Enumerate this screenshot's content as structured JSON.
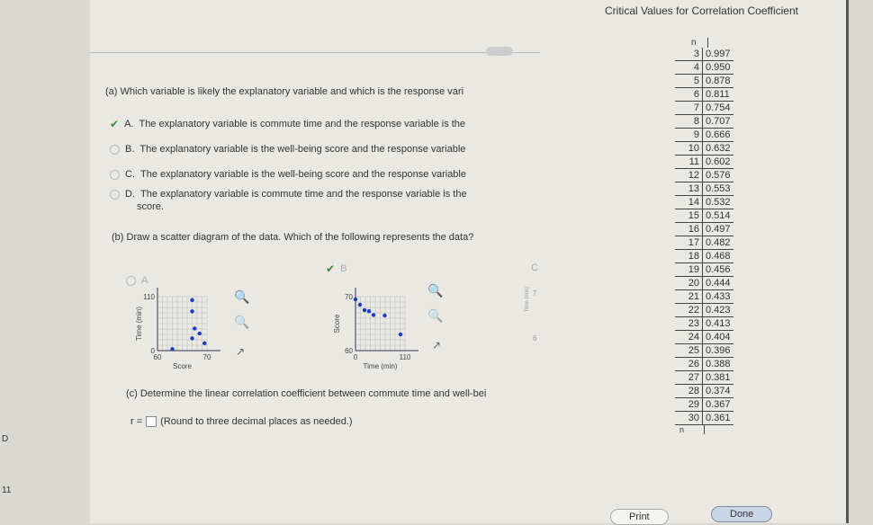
{
  "table": {
    "title": "Critical Values for Correlation Coefficient",
    "col_header": "n",
    "rows": [
      [
        3,
        "0.997"
      ],
      [
        4,
        "0.950"
      ],
      [
        5,
        "0.878"
      ],
      [
        6,
        "0.811"
      ],
      [
        7,
        "0.754"
      ],
      [
        8,
        "0.707"
      ],
      [
        9,
        "0.666"
      ],
      [
        10,
        "0.632"
      ],
      [
        11,
        "0.602"
      ],
      [
        12,
        "0.576"
      ],
      [
        13,
        "0.553"
      ],
      [
        14,
        "0.532"
      ],
      [
        15,
        "0.514"
      ],
      [
        16,
        "0.497"
      ],
      [
        17,
        "0.482"
      ],
      [
        18,
        "0.468"
      ],
      [
        19,
        "0.456"
      ],
      [
        20,
        "0.444"
      ],
      [
        21,
        "0.433"
      ],
      [
        22,
        "0.423"
      ],
      [
        23,
        "0.413"
      ],
      [
        24,
        "0.404"
      ],
      [
        25,
        "0.396"
      ],
      [
        26,
        "0.388"
      ],
      [
        27,
        "0.381"
      ],
      [
        28,
        "0.374"
      ],
      [
        29,
        "0.367"
      ],
      [
        30,
        "0.361"
      ]
    ],
    "footer": "n"
  },
  "part_a": {
    "question": "(a) Which variable is likely the explanatory variable and which is the response vari",
    "options": [
      {
        "letter": "A.",
        "text": "The explanatory variable is commute time and the response variable is the",
        "selected": true
      },
      {
        "letter": "B.",
        "text": "The explanatory variable is the well-being score and the response variable",
        "selected": false
      },
      {
        "letter": "C.",
        "text": "The explanatory variable is the well-being score and the response variable",
        "selected": false
      },
      {
        "letter": "D.",
        "text": "The explanatory variable is commute time and the response variable is the",
        "text2": "score.",
        "selected": false
      }
    ]
  },
  "part_b": {
    "question": "(b) Draw a scatter diagram of the data. Which of the following represents the data?",
    "options": [
      {
        "letter": "A",
        "selected": false
      },
      {
        "letter": "B",
        "selected": true
      },
      {
        "letter": "C",
        "selected": false
      }
    ]
  },
  "chart_data": [
    {
      "type": "scatter",
      "option": "A",
      "xlabel": "Score",
      "ylabel": "Time (min)",
      "xlim": [
        60,
        70
      ],
      "ylim": [
        0,
        110
      ],
      "xticks": [
        "60",
        "70"
      ],
      "yticks": [
        "0",
        "110"
      ],
      "x": [
        63,
        67,
        67,
        67.5,
        67,
        68.5,
        69.5
      ],
      "y": [
        3,
        103,
        80,
        45,
        25,
        35,
        15
      ]
    },
    {
      "type": "scatter",
      "option": "B",
      "xlabel": "Time (min)",
      "ylabel": "Score",
      "xlim": [
        0,
        110
      ],
      "ylim": [
        60,
        70
      ],
      "xticks": [
        "0",
        "110"
      ],
      "yticks": [
        "60",
        "70"
      ],
      "x": [
        0,
        10,
        20,
        30,
        40,
        65,
        100
      ],
      "y": [
        69.5,
        68.5,
        67.5,
        67.3,
        66.6,
        66.5,
        63
      ]
    },
    {
      "type": "scatter",
      "option": "C",
      "ylabel": "Time (min)",
      "yticks": [
        "7",
        "6"
      ]
    }
  ],
  "part_c": {
    "question": "(c) Determine the linear correlation coefficient between commute time and well-bei",
    "prefix": "r =",
    "input_value": "",
    "hint": "(Round to three decimal places as needed.)"
  },
  "buttons": {
    "print": "Print",
    "done": "Done"
  },
  "side_labels": {
    "left": "D",
    "bottom": "11"
  },
  "colors": {
    "point": "#1a3bc4",
    "accent": "#3a8a3a"
  }
}
